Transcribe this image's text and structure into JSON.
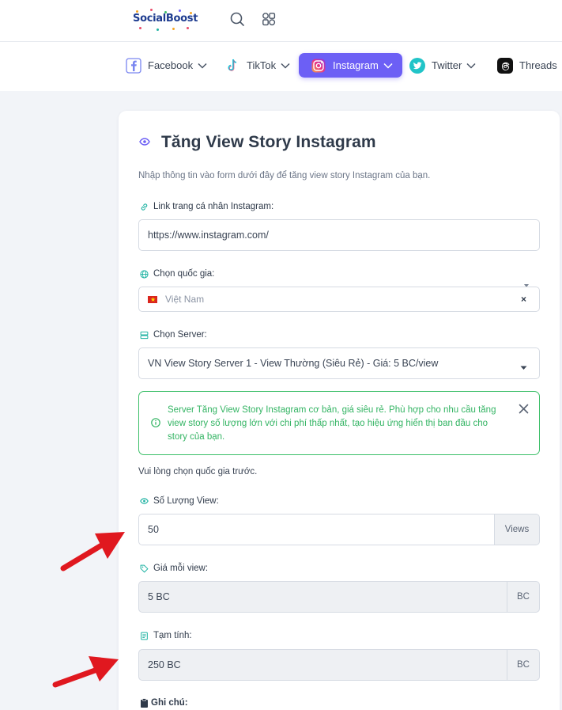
{
  "header": {
    "logo_text": "SocialBoost",
    "search_icon": "search-icon",
    "apps_icon": "apps-grid-icon"
  },
  "nav": {
    "items": [
      {
        "label": "Facebook",
        "icon": "facebook-icon"
      },
      {
        "label": "TikTok",
        "icon": "tiktok-icon"
      },
      {
        "label": "Instagram",
        "icon": "instagram-icon",
        "active": true
      },
      {
        "label": "Twitter",
        "icon": "twitter-icon"
      },
      {
        "label": "Threads",
        "icon": "threads-icon"
      }
    ]
  },
  "form": {
    "title": "Tăng View Story Instagram",
    "description": "Nhập thông tin vào form dưới đây để tăng view story Instagram của bạn.",
    "link": {
      "label": "Link trang cá nhân Instagram:",
      "value": "https://www.instagram.com/"
    },
    "country": {
      "label": "Chọn quốc gia:",
      "selected": "Việt Nam",
      "clear": "×"
    },
    "server": {
      "label": "Chọn Server:",
      "selected": "VN View Story Server 1 - View Thường (Siêu Rẻ) - Giá: 5 BC/view"
    },
    "alert": {
      "text": "Server Tăng View Story Instagram cơ bản, giá siêu rẻ. Phù hợp cho nhu cầu tăng view story số lượng lớn với chi phí thấp nhất, tạo hiệu ứng hiển thị ban đầu cho story của bạn."
    },
    "country_hint": "Vui lòng chọn quốc gia trước.",
    "quantity": {
      "label": "Số Lượng View:",
      "value": "50",
      "unit": "Views"
    },
    "price": {
      "label": "Giá mỗi view:",
      "value": "5 BC",
      "unit": "BC"
    },
    "subtotal": {
      "label": "Tạm tính:",
      "value": "250 BC",
      "unit": "BC"
    },
    "note": {
      "label": "Ghi chú:"
    }
  },
  "colors": {
    "accent": "#6c5ff5",
    "success": "#3cbf69",
    "icon_teal": "#20b3a3",
    "arrow": "#e0181f"
  }
}
